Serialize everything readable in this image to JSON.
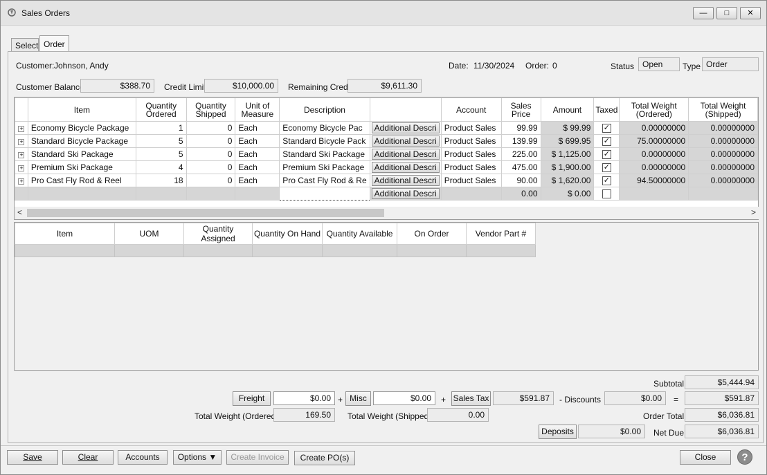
{
  "window": {
    "title": "Sales Orders",
    "min_glyph": "—",
    "max_glyph": "□",
    "close_glyph": "✕"
  },
  "tabs": [
    {
      "label": "Select"
    },
    {
      "label": "Order"
    }
  ],
  "header": {
    "customer_label": "Customer:",
    "customer_value": "Johnson, Andy",
    "date_label": "Date:",
    "date_value": "11/30/2024",
    "order_label": "Order:",
    "order_value": "0",
    "status_label": "Status",
    "status_value": "Open",
    "type_label": "Type",
    "type_value": "Order",
    "balance_label": "Customer Balance",
    "balance_value": "$388.70",
    "credit_limit_label": "Credit Limit",
    "credit_limit_value": "$10,000.00",
    "remaining_label": "Remaining Credit",
    "remaining_value": "$9,611.30"
  },
  "lines_grid": {
    "columns": [
      "Item",
      "Quantity Ordered",
      "Quantity Shipped",
      "Unit of Measure",
      "Description",
      "",
      "Account",
      "Sales Price",
      "Amount",
      "Taxed",
      "Total Weight (Ordered)",
      "Total Weight (Shipped)"
    ],
    "rows": [
      {
        "item": "Economy Bicycle Package",
        "qty_ordered": "1",
        "qty_shipped": "0",
        "uom": "Each",
        "description": "Economy Bicycle Pac",
        "add_desc": "Additional Descri",
        "account": "Product Sales",
        "price": "99.99",
        "amount": "$ 99.99",
        "taxed": true,
        "wt_ordered": "0.00000000",
        "wt_shipped": "0.00000000"
      },
      {
        "item": "Standard Bicycle Package",
        "qty_ordered": "5",
        "qty_shipped": "0",
        "uom": "Each",
        "description": "Standard Bicycle Pack",
        "add_desc": "Additional Descri",
        "account": "Product Sales",
        "price": "139.99",
        "amount": "$ 699.95",
        "taxed": true,
        "wt_ordered": "75.00000000",
        "wt_shipped": "0.00000000"
      },
      {
        "item": "Standard Ski Package",
        "qty_ordered": "5",
        "qty_shipped": "0",
        "uom": "Each",
        "description": "Standard Ski Package",
        "add_desc": "Additional Descri",
        "account": "Product Sales",
        "price": "225.00",
        "amount": "$ 1,125.00",
        "taxed": true,
        "wt_ordered": "0.00000000",
        "wt_shipped": "0.00000000"
      },
      {
        "item": "Premium Ski Package",
        "qty_ordered": "4",
        "qty_shipped": "0",
        "uom": "Each",
        "description": "Premium Ski Package",
        "add_desc": "Additional Descri",
        "account": "Product Sales",
        "price": "475.00",
        "amount": "$ 1,900.00",
        "taxed": true,
        "wt_ordered": "0.00000000",
        "wt_shipped": "0.00000000"
      },
      {
        "item": "Pro Cast Fly Rod & Reel",
        "qty_ordered": "18",
        "qty_shipped": "0",
        "uom": "Each",
        "description": "Pro Cast Fly Rod & Re",
        "add_desc": "Additional Descri",
        "account": "Product Sales",
        "price": "90.00",
        "amount": "$ 1,620.00",
        "taxed": true,
        "wt_ordered": "94.50000000",
        "wt_shipped": "0.00000000"
      }
    ],
    "new_row": {
      "add_desc": "Additional Descri",
      "price": "0.00",
      "amount": "$ 0.00",
      "taxed": false
    },
    "check_glyph": "✓",
    "expand_glyph": "+"
  },
  "scroll": {
    "left": "<",
    "right": ">"
  },
  "assign_grid": {
    "columns": [
      "Item",
      "UOM",
      "Quantity Assigned",
      "Quantity On Hand",
      "Quantity Available",
      "On Order",
      "Vendor Part #"
    ]
  },
  "totals": {
    "subtotal_label": "Subtotal",
    "subtotal_value": "$5,444.94",
    "freight_label": "Freight",
    "freight_value": "$0.00",
    "misc_label": "Misc",
    "misc_value": "$0.00",
    "sales_tax_label": "Sales Tax",
    "sales_tax_value": "$591.87",
    "discounts_label": "- Discounts",
    "discounts_value": "$0.00",
    "plus": "+",
    "equals": "=",
    "equals_value": "$591.87",
    "weight_ordered_label": "Total Weight (Ordered)",
    "weight_ordered_value": "169.50",
    "weight_shipped_label": "Total Weight (Shipped)",
    "weight_shipped_value": "0.00",
    "order_total_label": "Order Total",
    "order_total_value": "$6,036.81",
    "deposits_label": "Deposits",
    "deposits_value": "$0.00",
    "net_due_label": "Net Due",
    "net_due_value": "$6,036.81"
  },
  "footer": {
    "save": "Save",
    "clear": "Clear",
    "accounts": "Accounts",
    "options": "Options ▼",
    "create_invoice": "Create Invoice",
    "create_po": "Create PO(s)",
    "close": "Close",
    "help": "?"
  }
}
